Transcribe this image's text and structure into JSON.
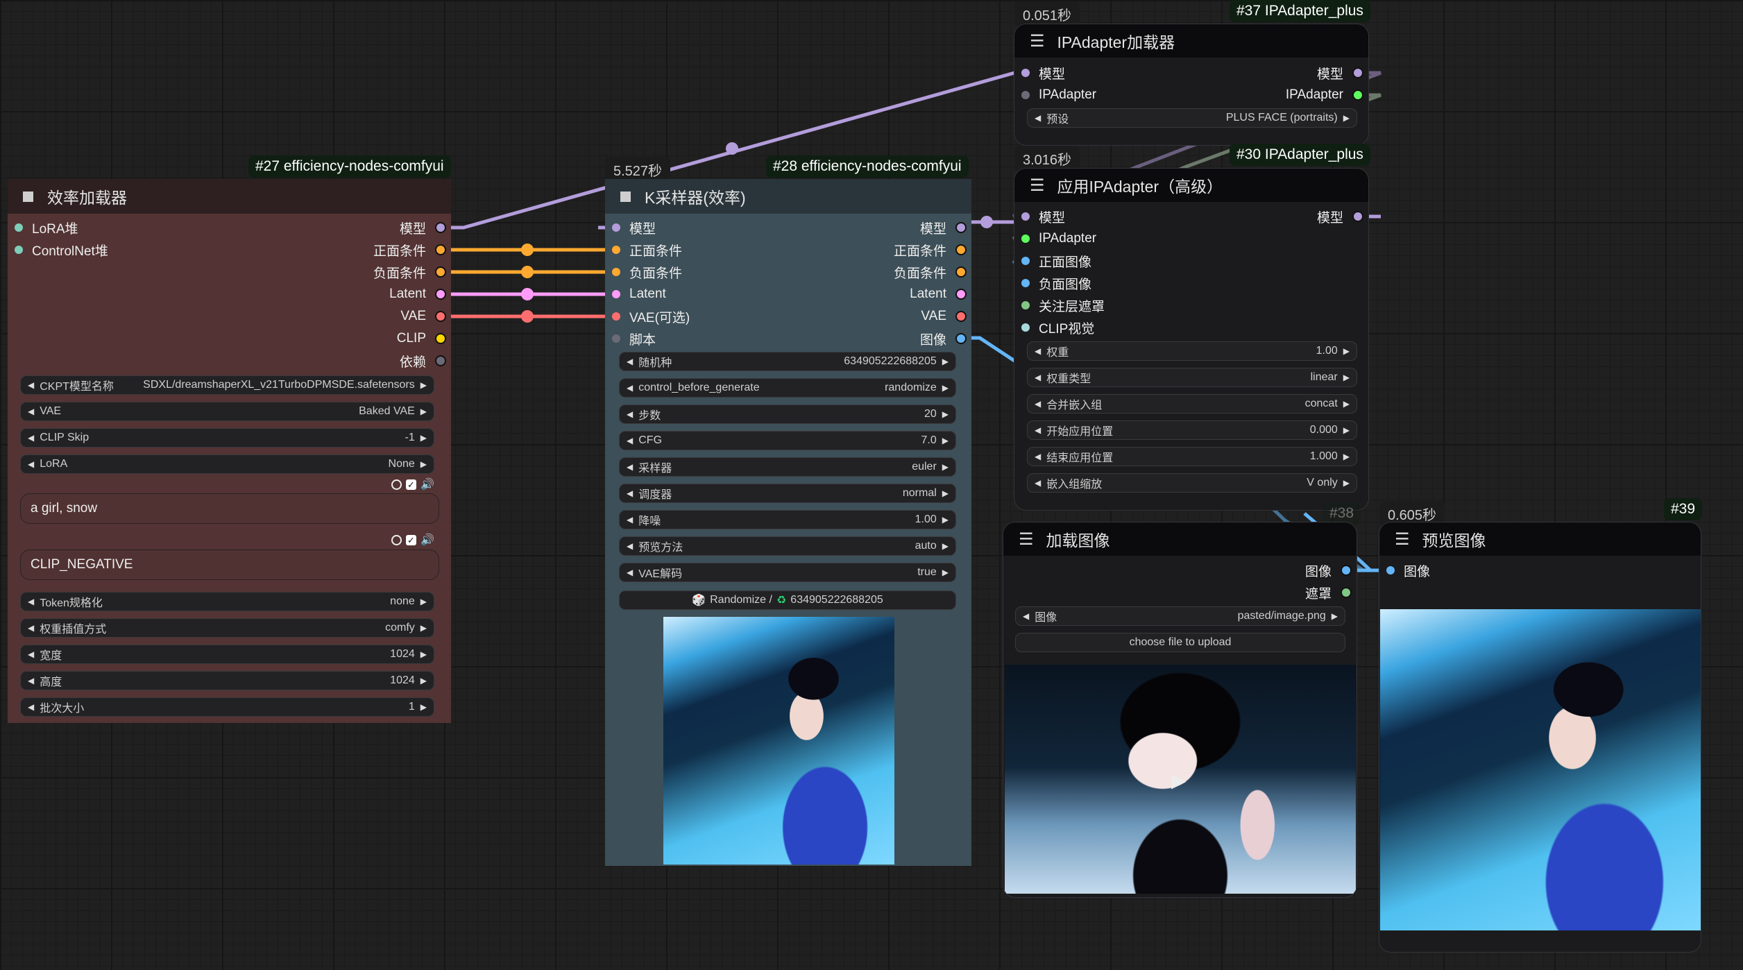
{
  "colors": {
    "model": "#b39ddb",
    "conditioning": "#ffa931",
    "latent": "#ff9cf9",
    "vae": "#ff6e6e",
    "clip": "#ffd500",
    "dependency": "#6b6b78",
    "image": "#64b5f6",
    "mask": "#81c784",
    "ipadapter": "#5eff5e",
    "clip_vision": "#a8dadc",
    "lora_stack": "#7ecdb8"
  },
  "nodes": {
    "eff_loader": {
      "badge": "#27 efficiency-nodes-comfyui",
      "title": "效率加载器",
      "inputs": [
        "LoRA堆",
        "ControlNet堆"
      ],
      "outputs": [
        "模型",
        "正面条件",
        "负面条件",
        "Latent",
        "VAE",
        "CLIP",
        "依赖"
      ],
      "widgets": [
        {
          "label": "CKPT模型名称",
          "value": "SDXL/dreamshaperXL_v21TurboDPMSDE.safetensors"
        },
        {
          "label": "VAE",
          "value": "Baked VAE"
        },
        {
          "label": "CLIP Skip",
          "value": "-1"
        },
        {
          "label": "LoRA",
          "value": "None"
        }
      ],
      "positive_prompt": "a girl, snow",
      "negative_prompt": "CLIP_NEGATIVE",
      "widgets2": [
        {
          "label": "Token规格化",
          "value": "none"
        },
        {
          "label": "权重插值方式",
          "value": "comfy"
        },
        {
          "label": "宽度",
          "value": "1024"
        },
        {
          "label": "高度",
          "value": "1024"
        },
        {
          "label": "批次大小",
          "value": "1"
        }
      ]
    },
    "ksampler": {
      "timing": "5.527秒",
      "badge": "#28 efficiency-nodes-comfyui",
      "title": "K采样器(效率)",
      "inputs": [
        "模型",
        "正面条件",
        "负面条件",
        "Latent",
        "VAE(可选)",
        "脚本"
      ],
      "outputs": [
        "模型",
        "正面条件",
        "负面条件",
        "Latent",
        "VAE",
        "图像"
      ],
      "widgets": [
        {
          "label": "随机种",
          "value": "634905222688205"
        },
        {
          "label": "control_before_generate",
          "value": "randomize"
        },
        {
          "label": "步数",
          "value": "20"
        },
        {
          "label": "CFG",
          "value": "7.0"
        },
        {
          "label": "采样器",
          "value": "euler"
        },
        {
          "label": "调度器",
          "value": "normal"
        },
        {
          "label": "降噪",
          "value": "1.00"
        },
        {
          "label": "预览方法",
          "value": "auto"
        },
        {
          "label": "VAE解码",
          "value": "true"
        }
      ],
      "randomize_label": "Randomize /",
      "randomize_seed": "634905222688205"
    },
    "ipadapter_loader": {
      "timing": "0.051秒",
      "badge": "#37 IPAdapter_plus",
      "title": "IPAdapter加载器",
      "inputs": [
        "模型",
        "IPAdapter"
      ],
      "outputs": [
        "模型",
        "IPAdapter"
      ],
      "widgets": [
        {
          "label": "预设",
          "value": "PLUS FACE (portraits)"
        }
      ]
    },
    "ipadapter_apply": {
      "timing": "3.016秒",
      "badge": "#30 IPAdapter_plus",
      "title": "应用IPAdapter（高级）",
      "inputs": [
        "模型",
        "IPAdapter",
        "正面图像",
        "负面图像",
        "关注层遮罩",
        "CLIP视觉"
      ],
      "outputs": [
        "模型"
      ],
      "widgets": [
        {
          "label": "权重",
          "value": "1.00"
        },
        {
          "label": "权重类型",
          "value": "linear"
        },
        {
          "label": "合并嵌入组",
          "value": "concat"
        },
        {
          "label": "开始应用位置",
          "value": "0.000"
        },
        {
          "label": "结束应用位置",
          "value": "1.000"
        },
        {
          "label": "嵌入组缩放",
          "value": "V only"
        }
      ]
    },
    "load_image": {
      "badge": "#38",
      "title": "加载图像",
      "outputs": [
        "图像",
        "遮罩"
      ],
      "widgets": [
        {
          "label": "图像",
          "value": "pasted/image.png"
        }
      ],
      "upload_label": "choose file to upload"
    },
    "preview": {
      "timing": "0.605秒",
      "badge": "#39",
      "title": "预览图像",
      "inputs": [
        "图像"
      ]
    }
  }
}
